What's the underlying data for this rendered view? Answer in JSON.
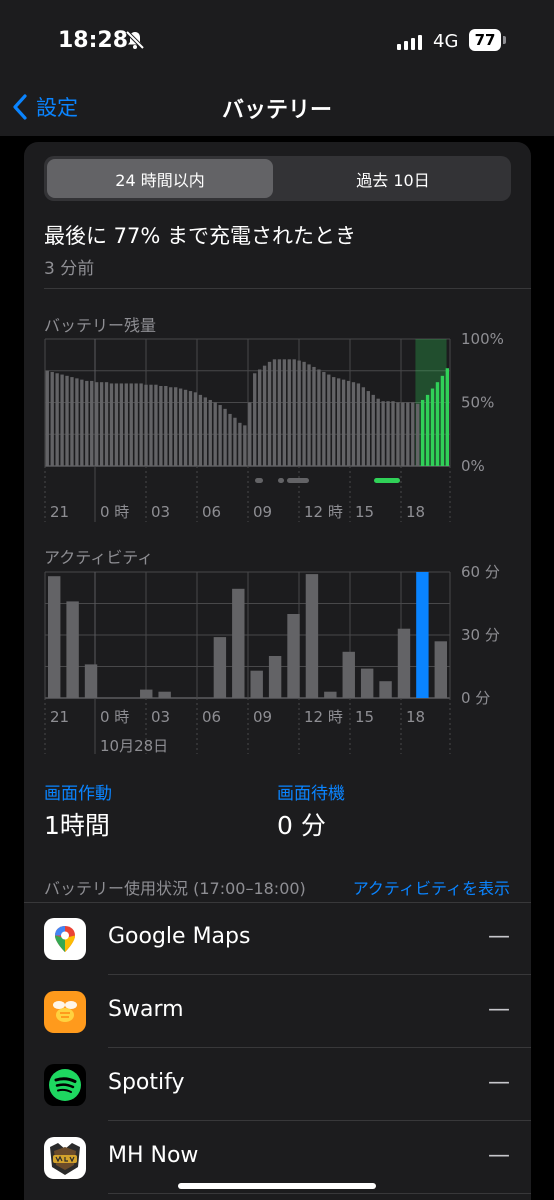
{
  "status": {
    "time": "18:28",
    "network": "4G",
    "battery": "77"
  },
  "nav": {
    "back_label": "設定",
    "title": "バッテリー"
  },
  "tabs": {
    "active": "24 時間以内",
    "inactive": "過去 10日"
  },
  "charge": {
    "text": "最後に 77% まで充電されたとき",
    "ago": "3 分前"
  },
  "battery_chart": {
    "label": "バッテリー残量",
    "ticks": [
      "100%",
      "50%",
      "0%"
    ],
    "x_labels": [
      "21",
      "0 時",
      "03",
      "06",
      "09",
      "12 時",
      "15",
      "18"
    ]
  },
  "activity_chart": {
    "label": "アクティビティ",
    "ticks": [
      "60 分",
      "30 分",
      "0 分"
    ],
    "x_labels": [
      "21",
      "0 時",
      "03",
      "06",
      "09",
      "12 時",
      "15",
      "18"
    ],
    "date_label": "10月28日"
  },
  "stats": {
    "screen_on_label": "画面作動",
    "screen_on_value": "1時間",
    "screen_off_label": "画面待機",
    "screen_off_value": "0 分"
  },
  "usage": {
    "header": "バッテリー使用状況 (17:00–18:00)",
    "link": "アクティビティを表示",
    "apps": [
      {
        "name": "Google Maps",
        "value": "—",
        "icon": "google-maps-icon"
      },
      {
        "name": "Swarm",
        "value": "—",
        "icon": "swarm-icon"
      },
      {
        "name": "Spotify",
        "value": "—",
        "icon": "spotify-icon"
      },
      {
        "name": "MH Now",
        "value": "—",
        "icon": "mh-now-icon"
      }
    ]
  },
  "chart_data": [
    {
      "type": "bar",
      "title": "バッテリー残量",
      "ylim": [
        0,
        100
      ],
      "x_ticks": [
        "21",
        "0 時",
        "03",
        "06",
        "09",
        "12 時",
        "15",
        "18"
      ],
      "values": [
        75,
        74,
        73,
        72,
        71,
        70,
        69,
        68,
        67,
        67,
        66,
        66,
        66,
        65,
        65,
        65,
        65,
        65,
        65,
        65,
        64,
        64,
        64,
        63,
        63,
        62,
        62,
        61,
        60,
        59,
        58,
        56,
        54,
        52,
        50,
        48,
        45,
        41,
        38,
        34,
        32,
        50,
        73,
        76,
        79,
        82,
        84,
        84,
        84,
        84,
        84,
        83,
        82,
        80,
        78,
        76,
        74,
        72,
        70,
        69,
        68,
        67,
        66,
        65,
        62,
        59,
        56,
        53,
        51,
        51,
        51,
        50,
        50,
        50,
        50,
        49,
        52,
        56,
        61,
        66,
        71,
        77
      ],
      "charging_tail_count": 6,
      "colors": {
        "normal": "#636366",
        "charging": "#30d158"
      }
    },
    {
      "type": "bar",
      "title": "アクティビティ",
      "ylim": [
        0,
        60
      ],
      "x_ticks": [
        "21",
        "0 時",
        "03",
        "06",
        "09",
        "12 時",
        "15",
        "18"
      ],
      "values": [
        58,
        46,
        16,
        0,
        0,
        4,
        3,
        0,
        0,
        29,
        52,
        13,
        20,
        40,
        59,
        3,
        22,
        14,
        8,
        33,
        60,
        27
      ],
      "highlight_index": 20,
      "colors": {
        "normal": "#636366",
        "highlight": "#0a84ff"
      }
    }
  ]
}
